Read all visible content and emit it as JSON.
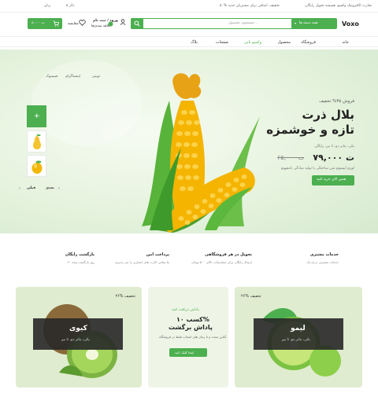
{
  "topbar": {
    "notice": "تجارت الکترونیک وکسو، همیشه تحویل رایگان",
    "discount": "۵۰% تخفیف، اضافی برای مشتریان جدید",
    "language": "زبان",
    "currency": "۵ دلار"
  },
  "header": {
    "logo": "Voxo",
    "category_select": "همه دسته ها",
    "search_placeholder": "جستجوی محصول...",
    "login": "ورود / ثبت نام",
    "wishlist": "علاقه مندی‌ها",
    "compare": "مقایسه",
    "cart_label": "خالی",
    "cart_total": "۸,۰۰۰ ت"
  },
  "nav": {
    "items": [
      "خانه",
      "فروشگاه",
      "محصول",
      "وکسو بانی",
      "صفحات",
      "بلاگ"
    ]
  },
  "hero": {
    "sale_tag": "فروش ۳۵% تخفیف",
    "title_line1": "بلال ذرت",
    "title_line2": "تازه و خوشمزه",
    "meta": "یکی، بنابر دو، تا بیز، رایگان",
    "price_old": "۶۵,۰۰۰ ت",
    "price_new": "۷۹,۰۰۰ ت",
    "desc": "لورم ایپسوم متن ساختگی با تولید سادگی نامفهوم",
    "cta": "همین الان خرید کنید",
    "social": [
      "فیسبوک",
      "اینستاگرام",
      "توییتر"
    ],
    "next": "بعدی",
    "prev": "قبلی"
  },
  "features": [
    {
      "title": "خدمات مشتری",
      "sub": "خدمات مشتری درجه یک"
    },
    {
      "title": "تحویل در هر فروشگاهی",
      "sub": "ارسال رایگان برای سفارشات بالای ۵۰۰ تومان"
    },
    {
      "title": "پرداخت امن",
      "sub": "ما تمامی کارت های اعتباری را می پذیریم"
    },
    {
      "title": "بازگشت رایگان",
      "sub": "۳۰ روز بازگشت وجه"
    }
  ],
  "cards": {
    "left": {
      "badge": "۲۶% تخفیف",
      "title": "کیوی",
      "sub": "یکی، بنابر دو، تا بیز"
    },
    "mid": {
      "top": "پاداش دریافت کنید",
      "line1": "کسب ۱۰%",
      "line2": "پاداش برگشت",
      "desc": "آنلاین مجدد و تا زمان های انتخاب فقط در فروشگاه",
      "cta": "اینجا کلیک کنید"
    },
    "right": {
      "badge": "۲۶% تخفیف",
      "title": "لیمو",
      "sub": "یکی، بنابر دو، تا بیز"
    }
  },
  "colors": {
    "accent": "#4caf50",
    "dark_panel": "#2f2f2f",
    "hero_bg": "#e6f3de"
  }
}
